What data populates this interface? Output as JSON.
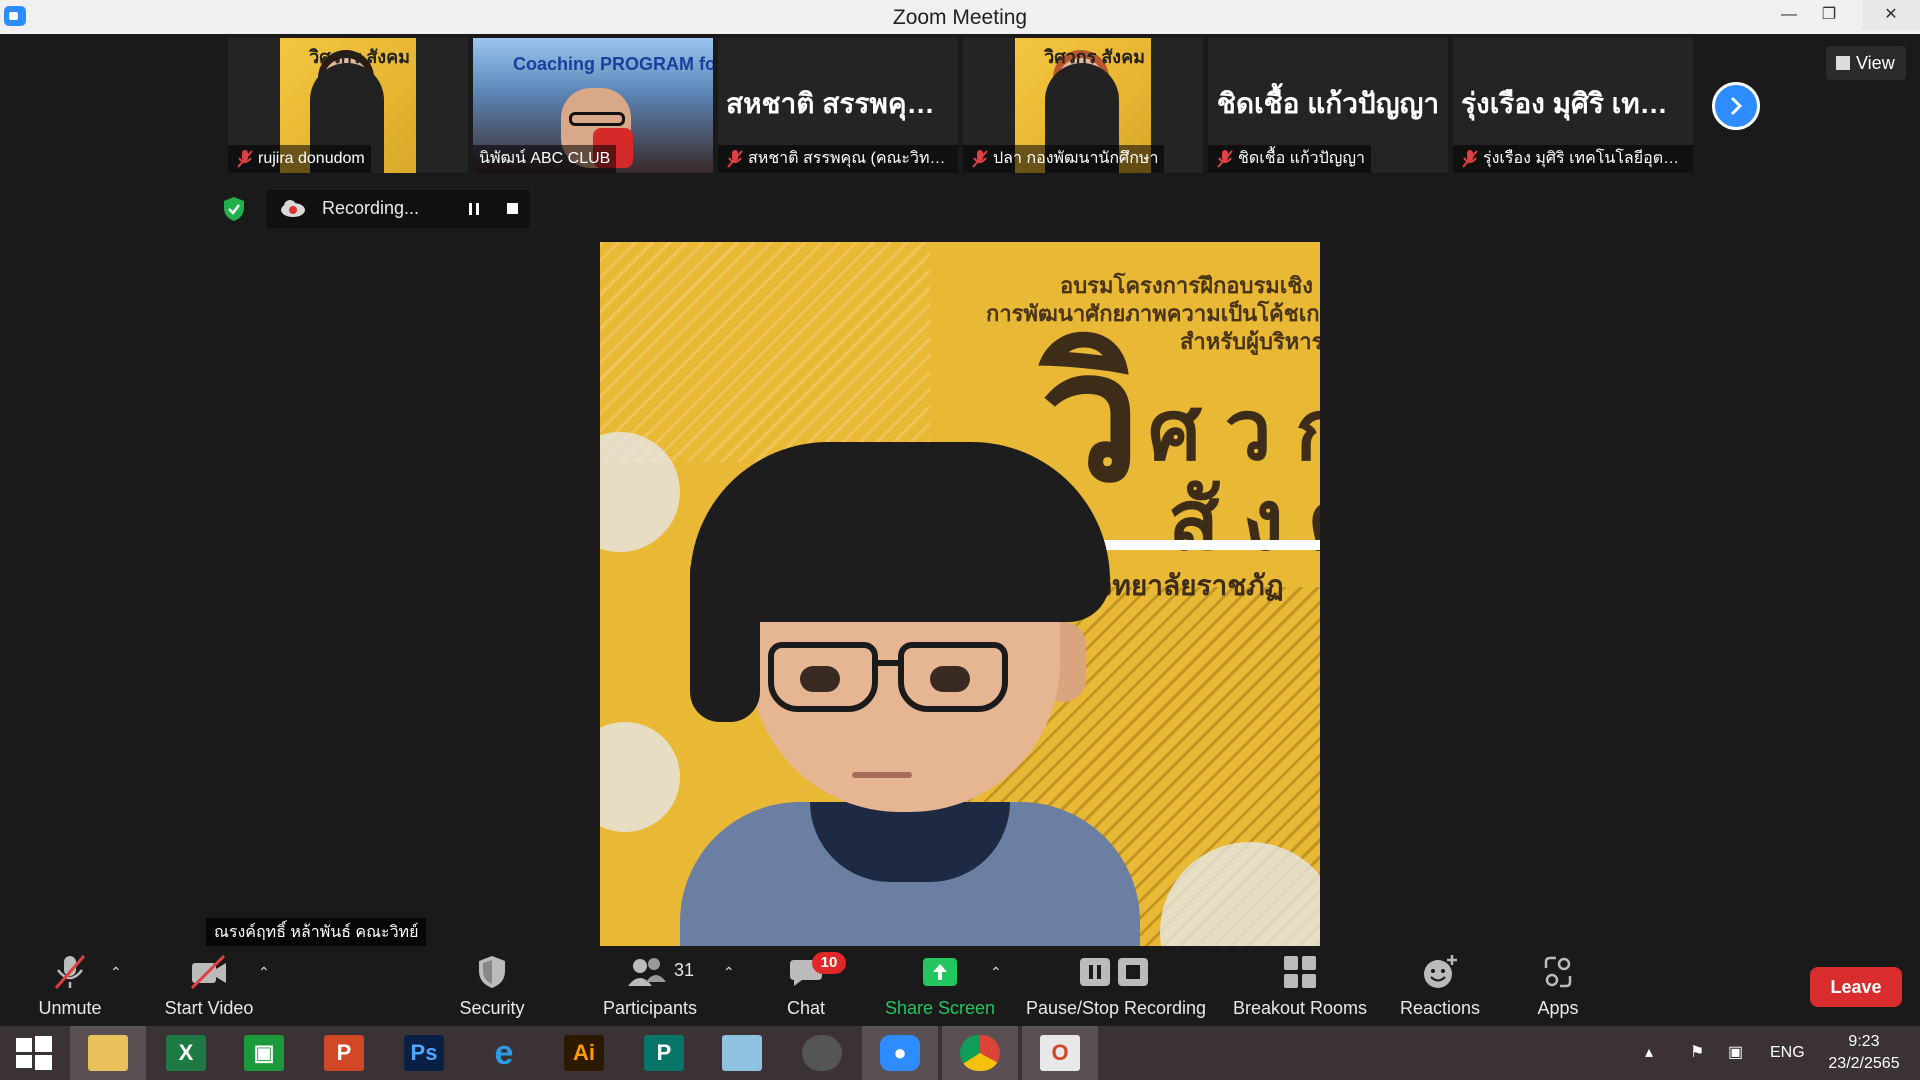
{
  "window": {
    "title": "Zoom Meeting"
  },
  "thumbnails": [
    {
      "name": "rujira donudom",
      "muted": true,
      "photo_caption": "วิศวกร สังคม"
    },
    {
      "name": "นิพัฒน์ ABC CLUB",
      "muted": false,
      "photo_caption": "Coaching PROGRAM for"
    },
    {
      "name": "สหชาติ สรรพคุณ (คณะวิทย์...",
      "muted": true,
      "display_name": "สหชาติ สรรพคุณ..."
    },
    {
      "name": "ปลา กองพัฒนานักศึกษา",
      "muted": true,
      "photo_caption": "วิศวกร สังคม"
    },
    {
      "name": "ชิดเชื้อ แก้วปัญญา",
      "muted": true,
      "display_name": "ชิดเชื้อ แก้วปัญญา"
    },
    {
      "name": "รุ่งเรือง มุศิริ เทคโนโลยีอุตสา...",
      "muted": true,
      "display_name": "รุ่งเรือง มุศิริ เทคโ..."
    }
  ],
  "view_button": {
    "label": "View"
  },
  "recording": {
    "status": "Recording..."
  },
  "main_video": {
    "banner_line1": "อบรมโครงการฝึกอบรมเชิง",
    "banner_line2": "การพัฒนาศักยภาพความเป็นโค้ชเก",
    "banner_line3": "สำหรับผู้บริหาร อา",
    "big_seven": "วิ",
    "big_row1": "ศ ว ก",
    "big_row2": "สั ง ค",
    "university": "มหาวิทยาลัยราชภัฏ"
  },
  "active_speaker": {
    "name": "ณรงค์ฤทธิ์ หล้าพันธ์ คณะวิทย์"
  },
  "toolbar": {
    "unmute": "Unmute",
    "start_video": "Start Video",
    "security": "Security",
    "participants": "Participants",
    "participants_count": "31",
    "chat": "Chat",
    "chat_badge": "10",
    "share_screen": "Share Screen",
    "pause_stop": "Pause/Stop Recording",
    "breakout": "Breakout Rooms",
    "reactions": "Reactions",
    "apps": "Apps",
    "leave": "Leave"
  },
  "taskbar": {
    "apps": [
      "start-menu",
      "file-explorer",
      "excel",
      "store",
      "powerpoint",
      "photoshop",
      "internet-explorer",
      "illustrator",
      "publisher",
      "notepad",
      "photoscape",
      "zoom",
      "chrome",
      "office"
    ],
    "language": "ENG",
    "time": "9:23",
    "date": "23/2/2565"
  },
  "colors": {
    "accent": "#2d8cff",
    "leave": "#d92c2c",
    "share": "#22c55e",
    "badge": "#e02828"
  }
}
